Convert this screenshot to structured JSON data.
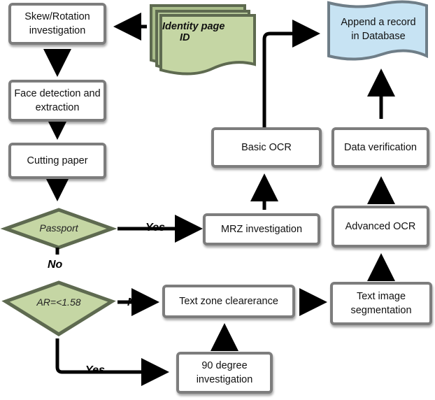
{
  "diagram": {
    "type": "flowchart",
    "nodes": {
      "skew": "Skew/Rotation investigation",
      "identity": "Identity page ID",
      "identity_line1": "Identity page",
      "identity_line2": "ID",
      "append": "Append a record in Database",
      "append_line1": "Append a record",
      "append_line2": "in Database",
      "face": "Face detection and extraction",
      "cutting": "Cutting paper",
      "basic_ocr": "Basic OCR",
      "data_verification": "Data verification",
      "passport": "Passport",
      "mrz": "MRZ investigation",
      "advanced_ocr": "Advanced OCR",
      "ar": "AR=<1.58",
      "text_zone": "Text zone clearerance",
      "text_seg": "Text image segmentation",
      "ninety": "90 degree investigation"
    },
    "edge_labels": {
      "passport_yes": "Yes",
      "passport_no": "No",
      "ar_no": "No",
      "ar_yes": "Yes"
    },
    "colors": {
      "decision_fill": "#c5d6a4",
      "decision_border": "#5e6a50",
      "document_fill": "#c5d6a4",
      "database_fill": "#c7e3f3",
      "box_border": "#7d7d7d"
    }
  }
}
